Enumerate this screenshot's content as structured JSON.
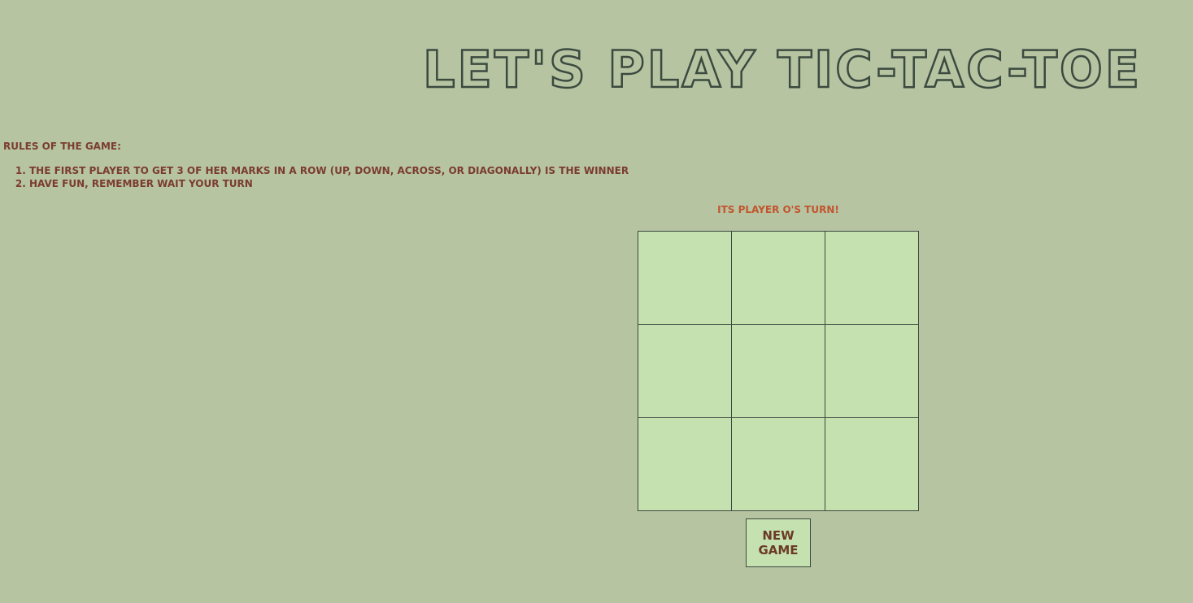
{
  "title": "Let's Play Tic-Tac-Toe",
  "rules": {
    "heading": "Rules of the game:",
    "items": [
      "The first player to get 3 of her marks in a row (up, down, across, or diagonally) is the winner",
      "Have fun, remember wait your turn"
    ]
  },
  "status": "Its player O's turn!",
  "board": {
    "cells": [
      "",
      "",
      "",
      "",
      "",
      "",
      "",
      "",
      ""
    ]
  },
  "new_game_label": "New Game",
  "colors": {
    "background": "#b6c4a2",
    "cell": "#c5e1b0",
    "rules_text": "#7b3c2f",
    "status_text": "#c2552e",
    "grid_lines": "#3b4a3f"
  }
}
